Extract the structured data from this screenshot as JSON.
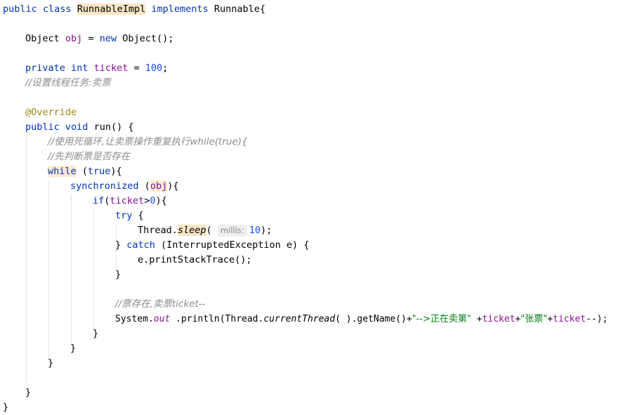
{
  "code": {
    "l1": {
      "kw1": "public",
      "kw2": "class",
      "name": "RunnableImpl",
      "kw3": "implements",
      "iface": "Runnable{"
    },
    "l3": {
      "type": "Object",
      "var": "obj",
      "eq": " = ",
      "kw": "new",
      "ctor": " Object();"
    },
    "l5": {
      "kw1": "private",
      "kw2": "int",
      "var": "ticket",
      "eq": " = ",
      "num": "100",
      "semi": ";"
    },
    "l6": {
      "comment": "//设置线程任务:卖票"
    },
    "l8": {
      "annotation": "@Override"
    },
    "l9": {
      "kw1": "public",
      "kw2": "void",
      "rest": " run() {"
    },
    "l10": {
      "comment": "//使用死循环,让卖票操作重复执行while(true){"
    },
    "l11": {
      "comment": "//先判断票是否存在"
    },
    "l12": {
      "kw": "while",
      "rest1": " (",
      "kw2": "true",
      "rest2": "){"
    },
    "l13": {
      "kw": "synchronized",
      "open": " (",
      "var": "obj",
      "close": "){"
    },
    "l14": {
      "kw": "if",
      "open": "(",
      "var": "ticket",
      "op": ">",
      "num": "0",
      "close": "){"
    },
    "l15": {
      "kw": "try",
      "rest": " {"
    },
    "l16": {
      "cls": "Thread.",
      "method": "sleep",
      "open": "(",
      "hint": "millis:",
      "num": "10",
      "close": ");"
    },
    "l17": {
      "close": "} ",
      "kw": "catch",
      "rest": " (InterruptedException e) {"
    },
    "l18": {
      "text": "e.printStackTrace();"
    },
    "l19": {
      "text": "}"
    },
    "l21": {
      "comment": "//票存在,卖票ticket--"
    },
    "l22": {
      "cls": "System.",
      "field": "out",
      "p1": " .println(Thread.",
      "method": "currentThread",
      "p2": "( ).getName()+",
      "s1": "\"-->正在卖第\"",
      "p3": " +",
      "v1": "ticket",
      "p4": "+",
      "s2": "\"张票\"",
      "p5": "+",
      "v2": "ticket",
      "p6": "--);"
    },
    "l23": {
      "text": "}"
    },
    "l24": {
      "text": "}"
    },
    "l25": {
      "text": "}"
    },
    "l27": {
      "text": "}"
    },
    "l28": {
      "text": "}"
    }
  },
  "colors": {
    "keyword": "#0033b3",
    "field": "#871094",
    "number": "#1750eb",
    "string": "#067d17",
    "annotation": "#9e880d",
    "comment": "#8c8c8c",
    "highlight": "#f8e6c4"
  }
}
